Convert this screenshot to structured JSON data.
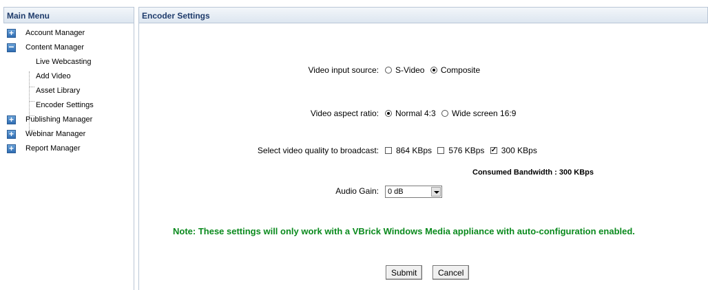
{
  "sidebar": {
    "title": "Main Menu",
    "items": [
      {
        "label": "Account Manager",
        "expander": "+"
      },
      {
        "label": "Content Manager",
        "expander": "−"
      },
      {
        "label": "Live Webcasting"
      },
      {
        "label": "Add Video"
      },
      {
        "label": "Asset Library"
      },
      {
        "label": "Encoder Settings"
      },
      {
        "label": "Publishing Manager",
        "expander": "+"
      },
      {
        "label": "Webinar Manager",
        "expander": "+"
      },
      {
        "label": "Report Manager",
        "expander": "+"
      }
    ]
  },
  "main": {
    "title": "Encoder Settings",
    "video_input": {
      "label": "Video input source:",
      "options": [
        {
          "label": "S-Video",
          "selected": false
        },
        {
          "label": "Composite",
          "selected": true
        }
      ]
    },
    "aspect_ratio": {
      "label": "Video aspect ratio:",
      "options": [
        {
          "label": "Normal 4:3",
          "selected": true
        },
        {
          "label": "Wide screen 16:9",
          "selected": false
        }
      ]
    },
    "quality": {
      "label": "Select video quality to broadcast:",
      "options": [
        {
          "label": "864 KBps",
          "checked": false
        },
        {
          "label": "576 KBps",
          "checked": false
        },
        {
          "label": "300 KBps",
          "checked": true
        }
      ]
    },
    "bandwidth": "Consumed Bandwidth : 300 KBps",
    "audio_gain": {
      "label": "Audio Gain:",
      "value": "0 dB"
    },
    "note": "Note: These settings will only work with a VBrick Windows Media appliance with auto-configuration enabled.",
    "submit_label": "Submit",
    "cancel_label": "Cancel"
  },
  "colors": {
    "header_text": "#1e3b6b",
    "note": "#0a8a1d",
    "border": "#b9c6d6"
  }
}
